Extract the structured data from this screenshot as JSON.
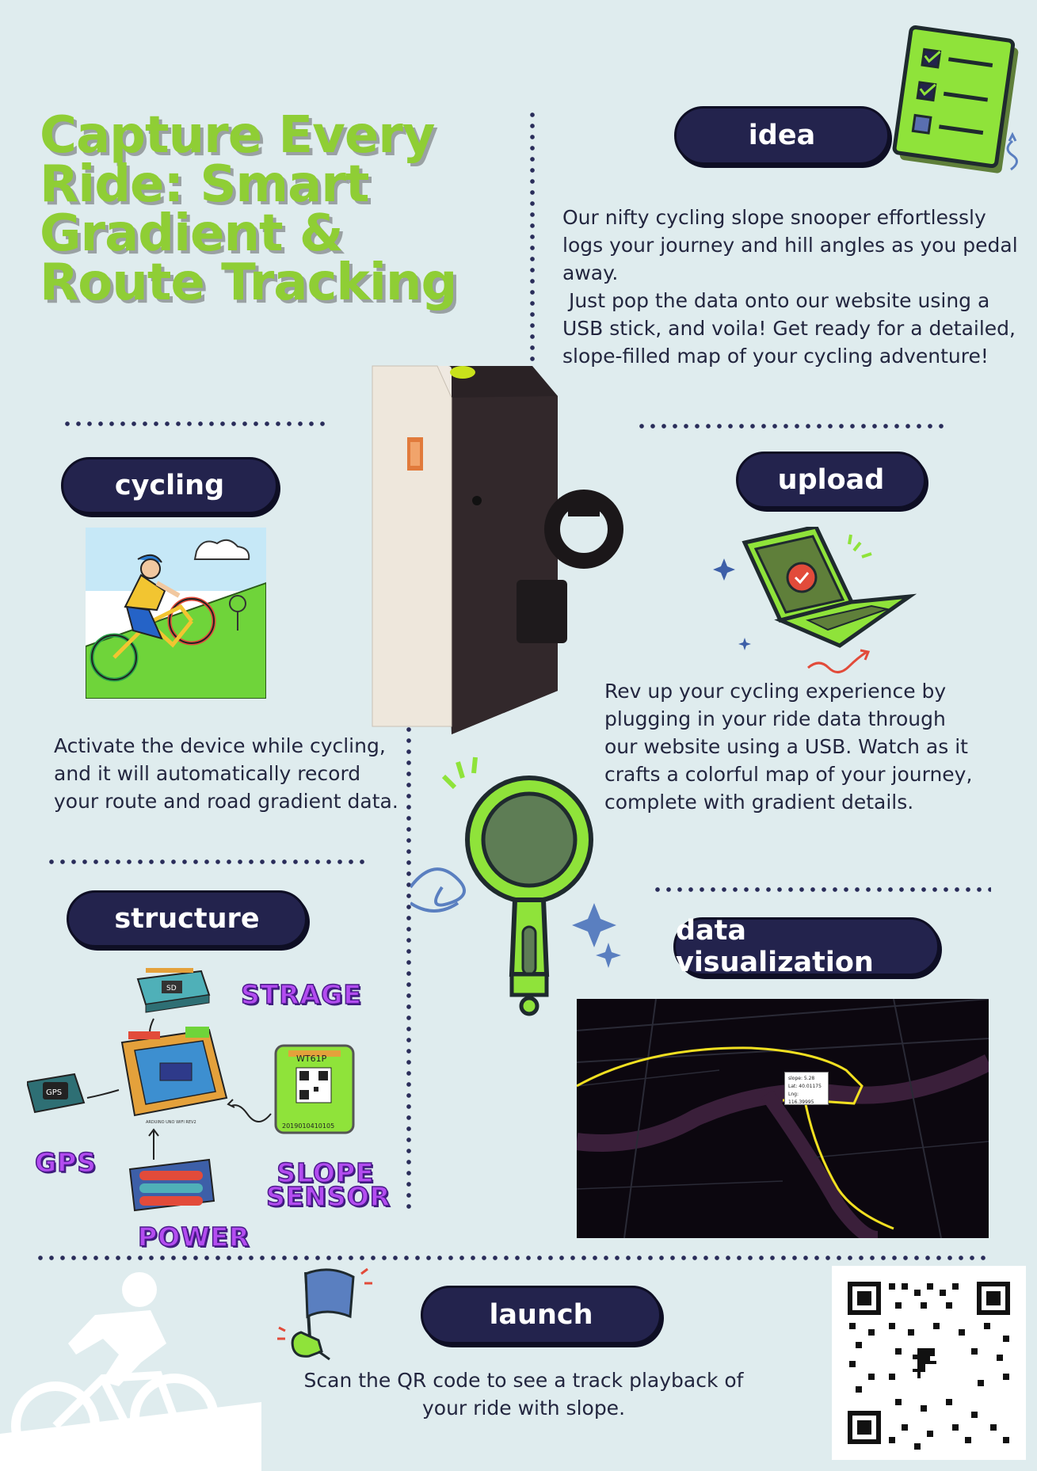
{
  "title": "Capture Every Ride: Smart Gradient & Route Tracking",
  "sections": {
    "idea": {
      "label": "idea",
      "text_line1": "Our nifty cycling slope snooper effortlessly logs your journey and hill angles as you pedal away.",
      "text_line2": " Just pop the data onto our website using a USB stick, and voila! Get ready for a detailed, slope-filled map of your cycling adventure!"
    },
    "cycling": {
      "label": "cycling",
      "text": "Activate the device while cycling, and it will automatically record your route and road gradient data."
    },
    "upload": {
      "label": "upload",
      "text": "Rev up your cycling experience by plugging in your ride data through our website using a USB. Watch as it crafts a colorful map of your journey, complete with gradient details."
    },
    "structure": {
      "label": "structure",
      "parts": {
        "storage": "STRAGE",
        "gps": "GPS",
        "slope_sensor": "SLOPE SENSOR",
        "power": "POWER"
      },
      "sd_chip_text": "SD",
      "gps_chip_text": "GPS",
      "board_text": "ARDUINO UNO WIFI REV2",
      "sensor_model": "WT61P",
      "sensor_serial": "2019010410105"
    },
    "data_visualization": {
      "label": "data visualization",
      "tooltip": {
        "slope": "slope: 5.28",
        "lat": "Lat: 40.01175",
        "lng": "Lng: 116.39995"
      }
    },
    "launch": {
      "label": "launch",
      "text": "Scan the QR code to see a track playback of your ride with slope."
    }
  },
  "colors": {
    "background": "#dfecee",
    "title_green": "#8fce35",
    "pill_navy": "#23234d",
    "accent_green": "#8fe33a",
    "route_yellow": "#f2e021",
    "purple_label": "#b34cf0"
  },
  "icons": [
    "checklist-icon",
    "laptop-icon",
    "magnifier-icon",
    "flag-icon",
    "cyclist-silhouette-icon",
    "qr-code"
  ]
}
